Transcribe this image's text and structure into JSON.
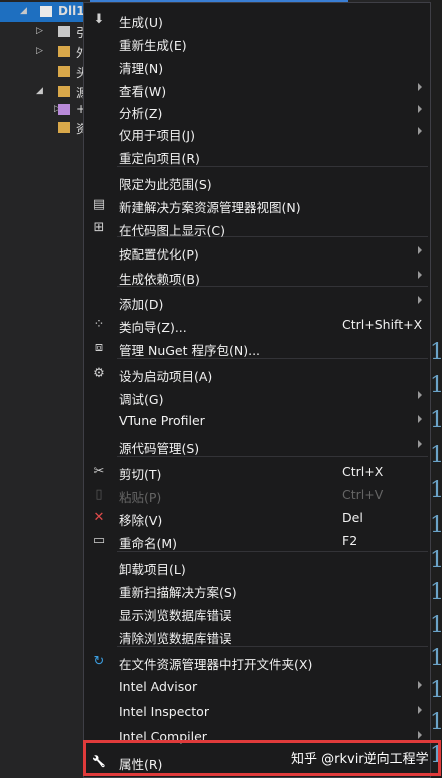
{
  "explorer": {
    "rows": [
      {
        "text": "Dll1",
        "selected": true
      },
      {
        "text": "引",
        "selected": false
      },
      {
        "text": "外",
        "selected": false
      },
      {
        "text": "头",
        "selected": false
      },
      {
        "text": "源",
        "selected": false
      },
      {
        "text": "+",
        "selected": false
      },
      {
        "text": "资",
        "selected": false
      }
    ]
  },
  "code_digits": [
    "1",
    "1",
    "1",
    "1",
    "1",
    "1",
    "1",
    "1",
    "1",
    "1",
    "1",
    "1",
    "1",
    "1",
    "1"
  ],
  "menu": {
    "items": [
      {
        "label": "生成(U)",
        "icon": "build-icon"
      },
      {
        "label": "重新生成(E)"
      },
      {
        "label": "清理(N)"
      },
      {
        "label": "查看(W)",
        "submenu": true
      },
      {
        "label": "分析(Z)",
        "submenu": true
      },
      {
        "label": "仅用于项目(J)",
        "submenu": true
      },
      {
        "label": "重定向项目(R)"
      },
      {
        "label": "限定为此范围(S)"
      },
      {
        "label": "新建解决方案资源管理器视图(N)",
        "icon": "new-view-icon"
      },
      {
        "label": "在代码图上显示(C)",
        "icon": "code-map-icon"
      },
      {
        "label": "按配置优化(P)",
        "submenu": true
      },
      {
        "label": "生成依赖项(B)",
        "submenu": true
      },
      {
        "label": "添加(D)",
        "submenu": true
      },
      {
        "label": "类向导(Z)...",
        "shortcut": "Ctrl+Shift+X",
        "icon": "class-wizard-icon"
      },
      {
        "label": "管理 NuGet 程序包(N)...",
        "icon": "nuget-icon"
      },
      {
        "label": "设为启动项目(A)",
        "icon": "gear-icon"
      },
      {
        "label": "调试(G)",
        "submenu": true
      },
      {
        "label": "VTune Profiler",
        "submenu": true
      },
      {
        "label": "源代码管理(S)",
        "submenu": true
      },
      {
        "label": "剪切(T)",
        "shortcut": "Ctrl+X",
        "icon": "scissors-icon"
      },
      {
        "label": "粘贴(P)",
        "shortcut": "Ctrl+V",
        "icon": "paste-icon",
        "disabled": true
      },
      {
        "label": "移除(V)",
        "shortcut": "Del",
        "icon": "remove-icon"
      },
      {
        "label": "重命名(M)",
        "shortcut": "F2",
        "icon": "rename-icon"
      },
      {
        "label": "卸载项目(L)"
      },
      {
        "label": "重新扫描解决方案(S)"
      },
      {
        "label": "显示浏览数据库错误"
      },
      {
        "label": "清除浏览数据库错误"
      },
      {
        "label": "在文件资源管理器中打开文件夹(X)",
        "icon": "open-folder-icon"
      },
      {
        "label": "Intel Advisor",
        "submenu": true
      },
      {
        "label": "Intel Inspector",
        "submenu": true
      },
      {
        "label": "Intel Compiler",
        "submenu": true
      },
      {
        "label": "属性(R)",
        "icon": "wrench-icon"
      }
    ]
  },
  "watermark": "知乎 @rkvir逆向工程学",
  "colors": {
    "menu_bg": "#1b1b1c",
    "highlight_border": "#e03b3b",
    "remove_icon": "#e04b4b",
    "open_folder_icon": "#3c9ee0"
  }
}
